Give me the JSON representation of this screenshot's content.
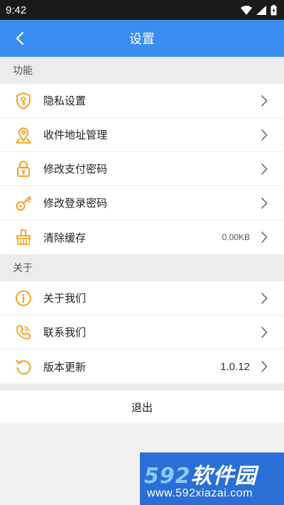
{
  "status_bar": {
    "time": "9:42"
  },
  "header": {
    "title": "设置",
    "back_icon": "chevron-left-icon"
  },
  "sections": {
    "functions": {
      "title": "功能",
      "items": [
        {
          "label": "隐私设置",
          "icon": "shield-key-icon"
        },
        {
          "label": "收件地址管理",
          "icon": "map-pin-icon"
        },
        {
          "label": "修改支付密码",
          "icon": "lock-yen-icon"
        },
        {
          "label": "修改登录密码",
          "icon": "key-icon"
        },
        {
          "label": "清除缓存",
          "icon": "broom-icon",
          "value": "0.00KB"
        }
      ]
    },
    "about": {
      "title": "关于",
      "items": [
        {
          "label": "关于我们",
          "icon": "info-icon"
        },
        {
          "label": "联系我们",
          "icon": "phone-icon"
        },
        {
          "label": "版本更新",
          "icon": "refresh-icon",
          "value": "1.0.12"
        }
      ]
    }
  },
  "logout": {
    "label": "退出"
  },
  "watermark": {
    "brand_num": "592",
    "brand_text": "软件园",
    "url": "www.592xiazai.com"
  },
  "colors": {
    "accent": "#3a8df0",
    "icon": "#f5a11b",
    "status_bar": "#1a1a1a",
    "watermark": "#2a6fd6"
  }
}
